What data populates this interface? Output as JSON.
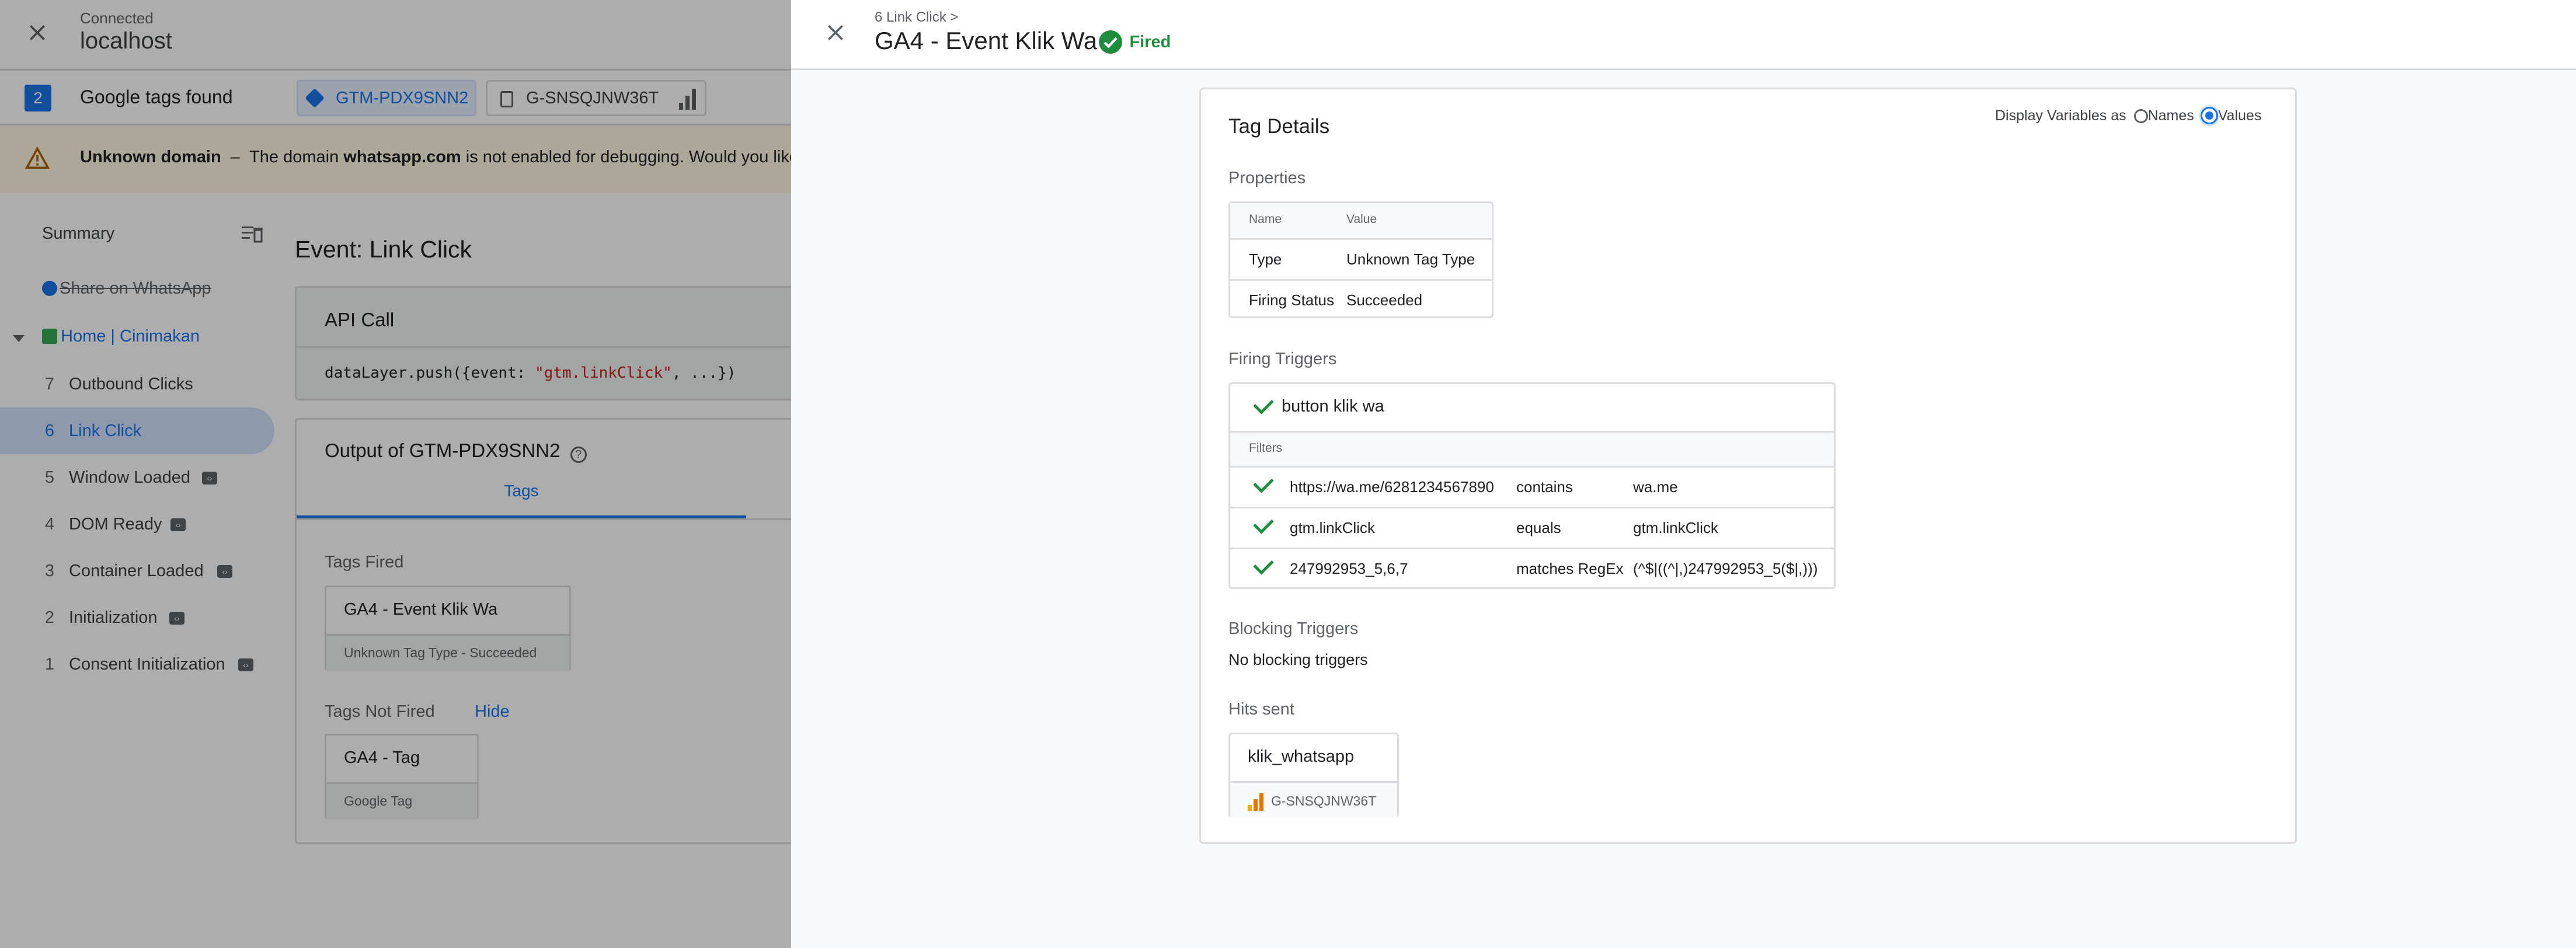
{
  "connection": {
    "status": "Connected",
    "host": "localhost"
  },
  "tags_found": {
    "count": "2",
    "label": "Google tags found",
    "containers": [
      "GTM-PDX9SNN2",
      "G-SNSQJNW36T"
    ]
  },
  "banner": {
    "strong": "Unknown domain",
    "dash": "–",
    "text_start": "The domain ",
    "domain": "whatsapp.com",
    "text_end": " is not enabled for debugging. Would you like to"
  },
  "sidebar": {
    "summary": "Summary",
    "share": "Share on WhatsApp",
    "home": "Home | Cinimakan",
    "items": [
      {
        "num": "7",
        "label": "Outbound Clicks",
        "chip": false
      },
      {
        "num": "6",
        "label": "Link Click",
        "chip": false,
        "active": true
      },
      {
        "num": "5",
        "label": "Window Loaded",
        "chip": true
      },
      {
        "num": "4",
        "label": "DOM Ready",
        "chip": true
      },
      {
        "num": "3",
        "label": "Container Loaded",
        "chip": true
      },
      {
        "num": "2",
        "label": "Initialization",
        "chip": true
      },
      {
        "num": "1",
        "label": "Consent Initialization",
        "chip": true
      }
    ]
  },
  "event": {
    "title": "Event: Link Click",
    "api_call": "API Call",
    "code_prefix": "dataLayer.push({event: ",
    "code_value": "\"gtm.linkClick\"",
    "code_suffix": ", ...})",
    "output_title": "Output of GTM-PDX9SNN2",
    "tab_tags": "Tags",
    "tags_fired": "Tags Fired",
    "fired_tag_name": "GA4 - Event Klik Wa",
    "fired_tag_sub": "Unknown Tag Type - Succeeded",
    "tags_not_fired": "Tags Not Fired",
    "hide": "Hide",
    "notfired_tag_name": "GA4 - Tag",
    "notfired_tag_sub": "Google Tag"
  },
  "panel": {
    "breadcrumb": "6 Link Click >",
    "title": "GA4 - Event Klik Wa",
    "status": "Fired",
    "card_title": "Tag Details",
    "display_label": "Display Variables as",
    "opt_names": "Names",
    "opt_values": "Values",
    "properties_title": "Properties",
    "props_headers": [
      "Name",
      "Value"
    ],
    "props": [
      {
        "name": "Type",
        "value": "Unknown Tag Type"
      },
      {
        "name": "Firing Status",
        "value": "Succeeded"
      }
    ],
    "firing_title": "Firing Triggers",
    "trigger_name": "button klik wa",
    "filters_label": "Filters",
    "filters": [
      {
        "left": "https://wa.me/6281234567890",
        "op": "contains",
        "right": "wa.me"
      },
      {
        "left": "gtm.linkClick",
        "op": "equals",
        "right": "gtm.linkClick"
      },
      {
        "left": "247992953_5,6,7",
        "op": "matches RegEx",
        "right": "(^$|((^|,)247992953_5($|,)))"
      }
    ],
    "blocking_title": "Blocking Triggers",
    "blocking_text": "No blocking triggers",
    "hits_title": "Hits sent",
    "hit_name": "klik_whatsapp",
    "hit_id": "G-SNSQJNW36T"
  },
  "colors": {
    "accent": "#1a73e8",
    "success": "#1e8e3e",
    "warning_bg": "#fef7e0"
  }
}
